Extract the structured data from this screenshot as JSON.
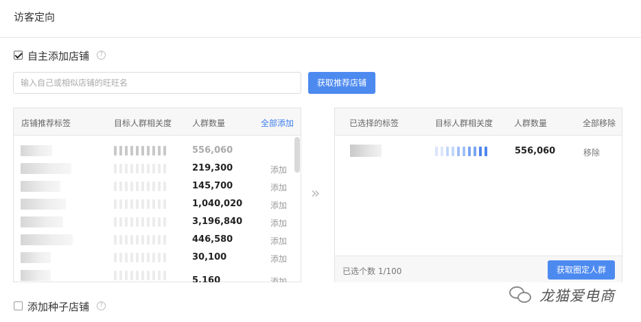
{
  "section": {
    "title": "访客定向"
  },
  "self_add": {
    "label": "自主添加店铺",
    "checked": true
  },
  "search": {
    "placeholder": "输入自己或相似店铺的旺旺名",
    "value": ""
  },
  "fetch_button": {
    "label": "获取推荐店铺"
  },
  "left_panel": {
    "headers": {
      "tag": "店铺推荐标签",
      "relevance": "目标人群相关度",
      "count": "人群数量",
      "add_all": "全部添加"
    },
    "rows": [
      {
        "count": "556,060",
        "action": "",
        "relevance_level": 10,
        "added": true
      },
      {
        "count": "219,300",
        "action": "添加",
        "relevance_level": 0,
        "added": false
      },
      {
        "count": "145,700",
        "action": "添加",
        "relevance_level": 0,
        "added": false
      },
      {
        "count": "1,040,020",
        "action": "添加",
        "relevance_level": 0,
        "added": false
      },
      {
        "count": "3,196,840",
        "action": "添加",
        "relevance_level": 0,
        "added": false
      },
      {
        "count": "446,580",
        "action": "添加",
        "relevance_level": 0,
        "added": false
      },
      {
        "count": "30,100",
        "action": "添加",
        "relevance_level": 0,
        "added": false
      },
      {
        "count": "5,160",
        "action": "添加",
        "relevance_level": 0,
        "added": false
      }
    ]
  },
  "right_panel": {
    "headers": {
      "tag": "已选择的标签",
      "relevance": "目标人群相关度",
      "count": "人群数量",
      "remove_all": "全部移除"
    },
    "rows": [
      {
        "count": "556,060",
        "action": "移除"
      }
    ],
    "footer": {
      "selected_count": "已选个数 1/100",
      "button": "获取圈定人群"
    }
  },
  "seed_add": {
    "label": "添加种子店铺",
    "checked": false
  },
  "watermark": {
    "text": "龙猫爱电商"
  },
  "icons": {
    "help": "question-circle-icon",
    "transfer": "double-chevron-right-icon",
    "watermark": "wechat-icon"
  },
  "colors": {
    "primary": "#4d8af0",
    "link": "#3b7ded"
  }
}
